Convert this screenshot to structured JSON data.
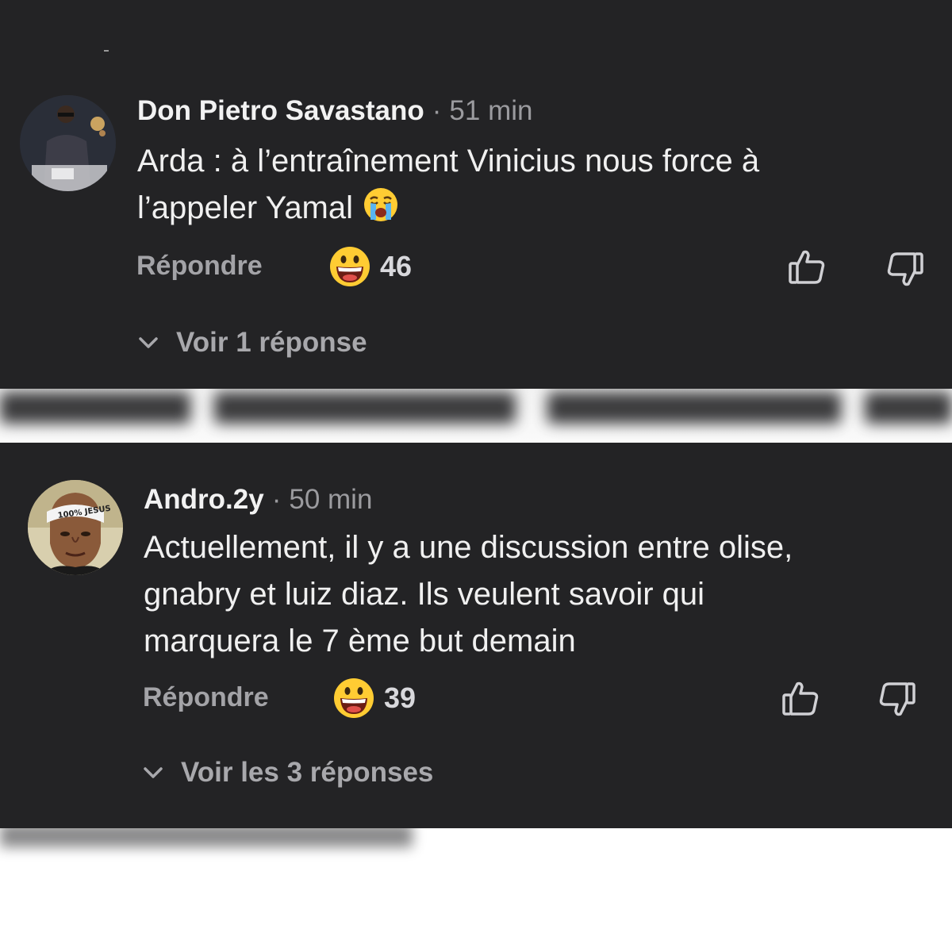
{
  "comments": [
    {
      "author": "Don Pietro Savastano",
      "separator": "·",
      "time": "51 min",
      "text_line1": "Arda : à l’entraînement Vinicius nous force à",
      "text_line2": "l’appeler Yamal",
      "inline_emoji": "loudly-crying-face",
      "reply_label": "Répondre",
      "reaction_emoji": "grinning-face-with-big-eyes",
      "reaction_count": "46",
      "view_replies_label": "Voir 1 réponse"
    },
    {
      "author": "Andro.2y",
      "separator": "·",
      "time": "50 min",
      "text_line1": "Actuellement, il y a une discussion entre olise,",
      "text_line2": "gnabry et luiz diaz. Ils veulent savoir qui",
      "text_line3": "marquera le 7 ème but demain",
      "reply_label": "Répondre",
      "reaction_emoji": "grinning-face-with-big-eyes",
      "reaction_count": "39",
      "view_replies_label": "Voir les 3 réponses"
    }
  ],
  "colors": {
    "panel_bg": "#232325",
    "text_primary": "#f0f0f0",
    "text_secondary": "#9b9b9f",
    "emoji_yellow": "#ffcc33"
  },
  "icons": [
    "thumbs-up-icon",
    "thumbs-down-icon",
    "chevron-down-icon"
  ]
}
